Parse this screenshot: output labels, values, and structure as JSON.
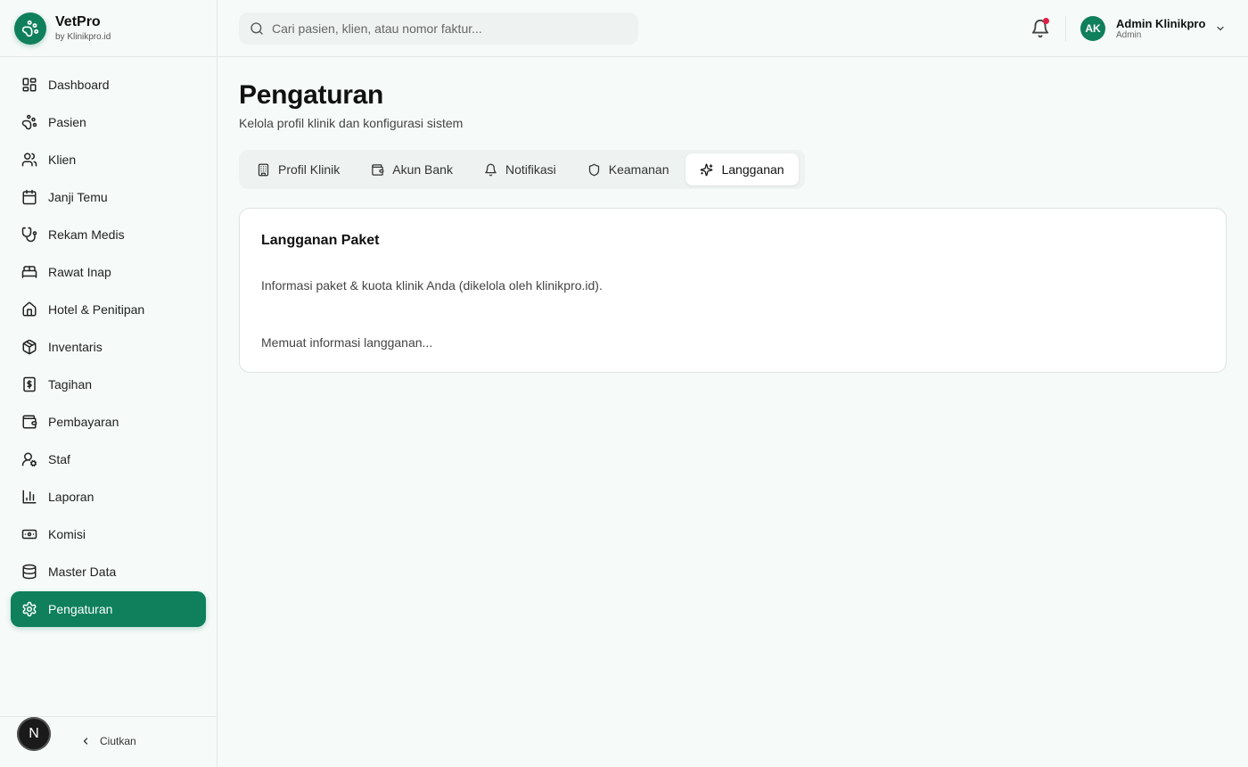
{
  "brand": {
    "name": "VetPro",
    "sub": "by Klinikpro.id",
    "accent": "#0f7f5c"
  },
  "sidebar": {
    "items": [
      {
        "label": "Dashboard",
        "icon": "dashboard-icon"
      },
      {
        "label": "Pasien",
        "icon": "paw-icon"
      },
      {
        "label": "Klien",
        "icon": "users-icon"
      },
      {
        "label": "Janji Temu",
        "icon": "calendar-icon"
      },
      {
        "label": "Rekam Medis",
        "icon": "stethoscope-icon"
      },
      {
        "label": "Rawat Inap",
        "icon": "bed-icon"
      },
      {
        "label": "Hotel & Penitipan",
        "icon": "home-icon"
      },
      {
        "label": "Inventaris",
        "icon": "package-icon"
      },
      {
        "label": "Tagihan",
        "icon": "receipt-icon"
      },
      {
        "label": "Pembayaran",
        "icon": "wallet-icon"
      },
      {
        "label": "Staf",
        "icon": "user-cog-icon"
      },
      {
        "label": "Laporan",
        "icon": "bar-chart-icon"
      },
      {
        "label": "Komisi",
        "icon": "banknote-icon"
      },
      {
        "label": "Master Data",
        "icon": "database-icon"
      },
      {
        "label": "Pengaturan",
        "icon": "settings-icon",
        "active": true
      }
    ],
    "footer": {
      "badge": "N",
      "collapse_label": "Ciutkan"
    }
  },
  "topbar": {
    "search_placeholder": "Cari pasien, klien, atau nomor faktur...",
    "user": {
      "initials": "AK",
      "name": "Admin Klinikpro",
      "role": "Admin"
    },
    "notification_dot_color": "#e11d48"
  },
  "page": {
    "title": "Pengaturan",
    "subtitle": "Kelola profil klinik dan konfigurasi sistem",
    "tabs": [
      {
        "label": "Profil Klinik",
        "icon": "building-icon"
      },
      {
        "label": "Akun Bank",
        "icon": "wallet-icon"
      },
      {
        "label": "Notifikasi",
        "icon": "bell-icon"
      },
      {
        "label": "Keamanan",
        "icon": "shield-icon"
      },
      {
        "label": "Langganan",
        "icon": "sparkles-icon",
        "active": true
      }
    ],
    "card": {
      "title": "Langganan Paket",
      "description": "Informasi paket & kuota klinik Anda (dikelola oleh klinikpro.id).",
      "loading": "Memuat informasi langganan..."
    }
  }
}
